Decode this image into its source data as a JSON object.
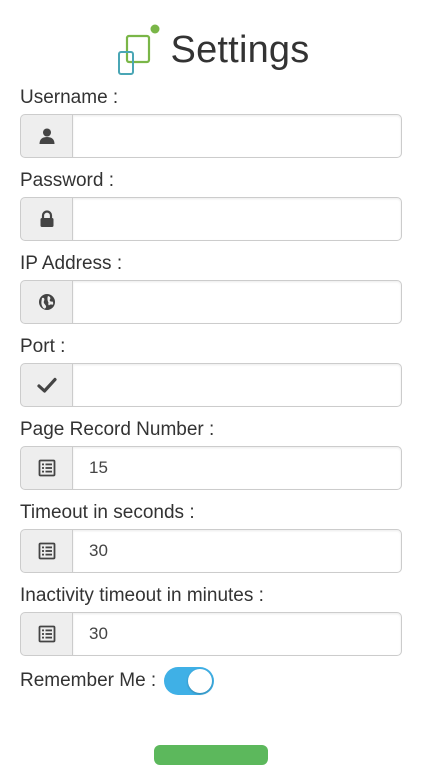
{
  "header": {
    "title": "Settings",
    "logo_icon": "devices-logo-icon"
  },
  "fields": [
    {
      "label": "Username :",
      "icon": "user-icon",
      "value": ""
    },
    {
      "label": "Password :",
      "icon": "lock-icon",
      "value": ""
    },
    {
      "label": "IP Address :",
      "icon": "globe-icon",
      "value": ""
    },
    {
      "label": "Port :",
      "icon": "checkmark-icon",
      "value": ""
    },
    {
      "label": "Page Record Number :",
      "icon": "list-icon",
      "value": "15"
    },
    {
      "label": "Timeout in seconds :",
      "icon": "list-icon",
      "value": "30"
    },
    {
      "label": "Inactivity timeout in minutes :",
      "icon": "list-icon",
      "value": "30"
    }
  ],
  "remember_me": {
    "label": "Remember Me :",
    "checked": true
  },
  "colors": {
    "toggle_on": "#3fb0e6",
    "logo_green": "#7ab648",
    "logo_teal": "#4aa6b5",
    "button_green": "#5cb85c"
  }
}
